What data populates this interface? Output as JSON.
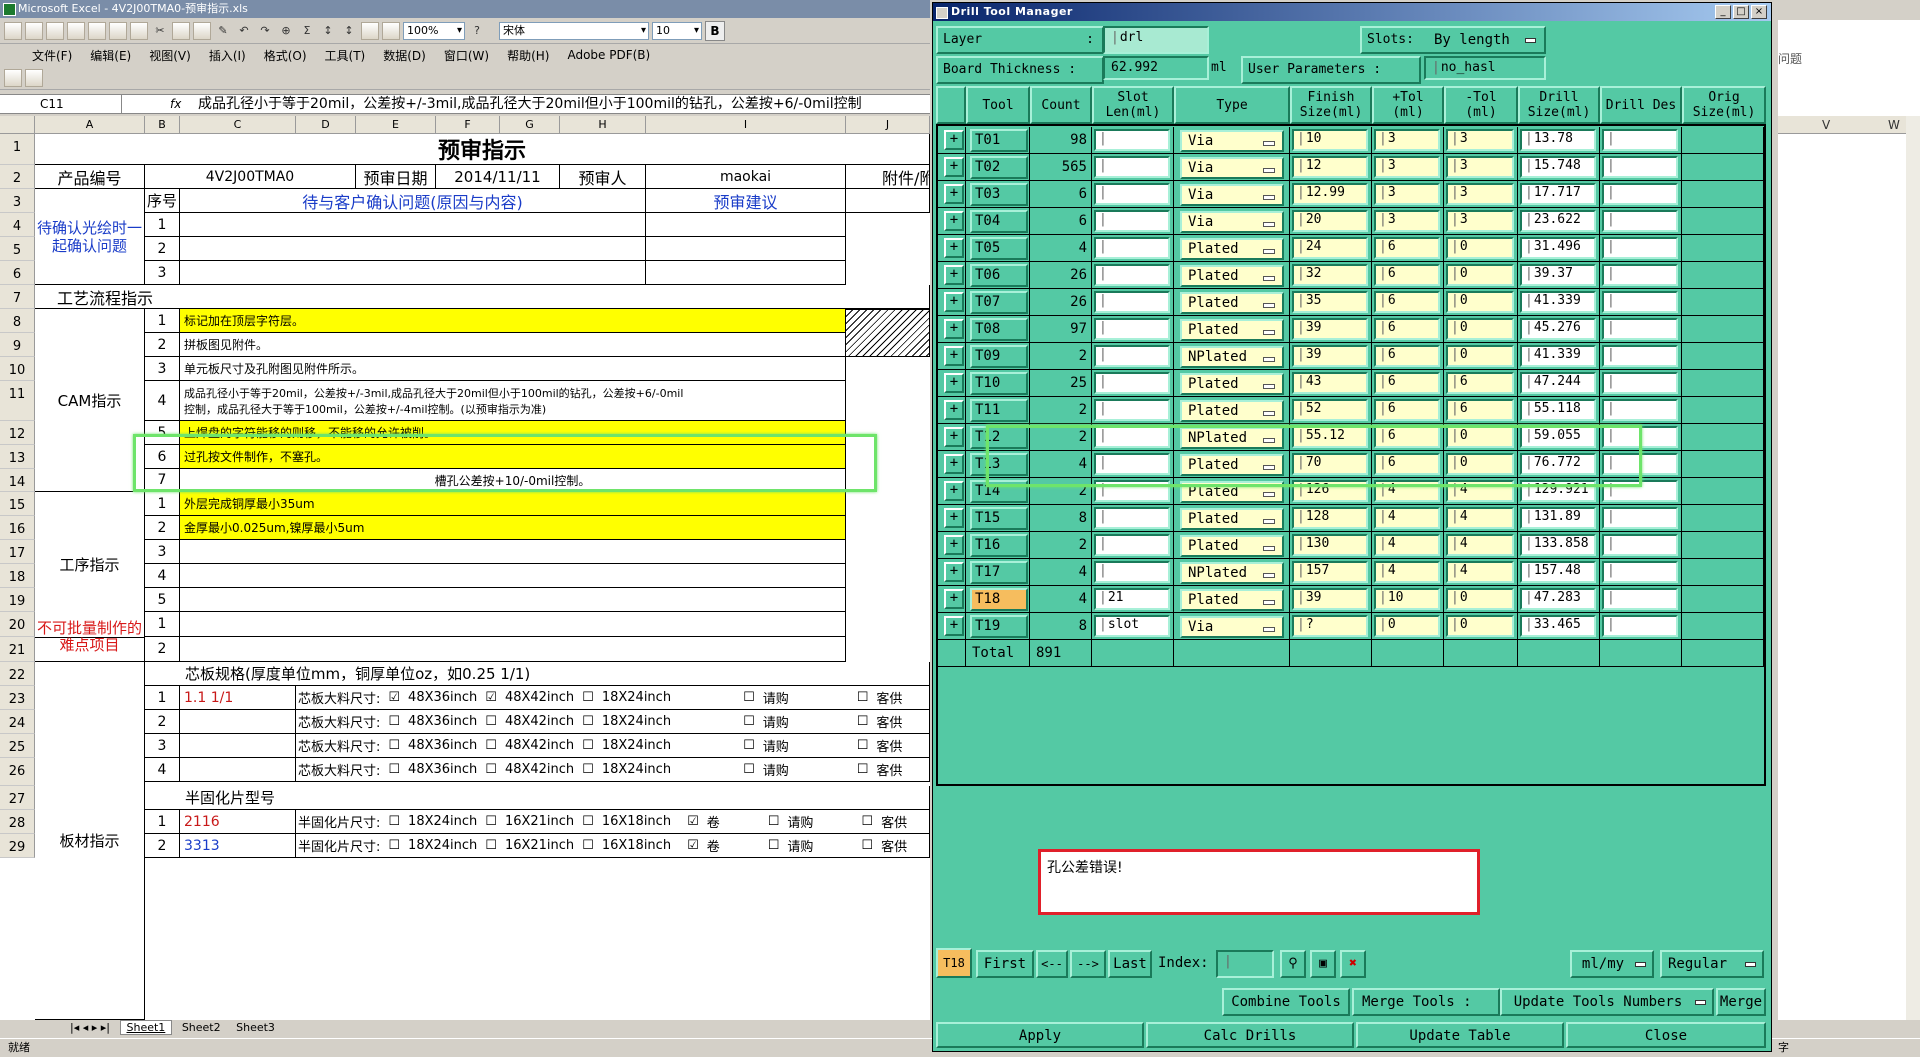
{
  "excel": {
    "window_title": "Microsoft Excel - 4V2J00TMA0-预审指示.xls",
    "font_name": "宋体",
    "font_size": "10",
    "zoom": "100%",
    "menus": [
      "文件(F)",
      "编辑(E)",
      "视图(V)",
      "插入(I)",
      "格式(O)",
      "工具(T)",
      "数据(D)",
      "窗口(W)",
      "帮助(H)",
      "Adobe PDF(B)"
    ],
    "name_box": "C11",
    "fx": "fx",
    "formula": "成品孔径小于等于20mil，公差按+/-3mil,成品孔径大于20mil但小于100mil的钻孔，公差按+6/-0mil控制",
    "columns": [
      "A",
      "B",
      "C",
      "D",
      "E",
      "F",
      "G",
      "H",
      "I",
      "J"
    ],
    "right_columns": [
      "V",
      "W"
    ],
    "right_text": "问题",
    "rows": [
      "1",
      "2",
      "3",
      "4",
      "5",
      "6",
      "7",
      "8",
      "9",
      "10",
      "11",
      "12",
      "13",
      "14",
      "15",
      "16",
      "17",
      "18",
      "19",
      "20",
      "21",
      "22",
      "23",
      "24",
      "25",
      "26",
      "27",
      "28",
      "29"
    ],
    "title": "预审指示",
    "product_no_label": "产品编号",
    "product_no": "4V2J00TMA0",
    "date_label": "预审日期",
    "date": "2014/11/11",
    "reviewer_label": "预审人",
    "reviewer": "maokai",
    "attach_label": "附件/附",
    "seq_label": "序号",
    "confirm_q": "待与客户确认问题(原因与内容)",
    "suggest": "预审建议",
    "confirm_section": "待确认光绘时一起确认问题",
    "flow": "工艺流程指示",
    "cam": "CAM指示",
    "cam_items": [
      "标记加在顶层字符层。",
      "拼板图见附件。",
      "单元板尺寸及孔附图见附件所示。",
      "成品孔径小于等于20mil，公差按+/-3mil,成品孔径大于20mil但小于100mil的钻孔，公差按+6/-0mil",
      "控制，成品孔径大于等于100mil，公差按+/-4mil控制。(以预审指示为准)",
      "上焊盘的字符能移的则移，不能移的允许被削。",
      "过孔按文件制作，不塞孔。",
      "槽孔公差按+10/-0mil控制。"
    ],
    "proc": "工序指示",
    "proc_items": [
      "外层完成铜厚最小35um",
      "金厚最小0.025um,镍厚最小5um"
    ],
    "no_batch": "不可批量制作的难点项目",
    "board": "板材指示",
    "core_spec": "芯板规格(厚度单位mm，铜厚单位oz，如0.25 1/1)",
    "core_value": "1.1 1/1",
    "core_size_label": "芯板大料尺寸:",
    "sizes": [
      "48X36inch",
      "48X42inch",
      "18X24inch"
    ],
    "buy": "请购",
    "customer": "客供",
    "prepreg": "半固化片型号",
    "prepreg_items": [
      "2116",
      "3313"
    ],
    "prepreg_size_label": "半固化片尺寸:",
    "pp_sizes": [
      "18X24inch",
      "16X21inch",
      "16X18inch"
    ],
    "roll": "卷",
    "seq_nums": [
      "1",
      "2",
      "3",
      "4",
      "5",
      "6",
      "7"
    ],
    "sheets": [
      "Sheet1",
      "Sheet2",
      "Sheet3"
    ],
    "status": "就绪",
    "status_right": "字"
  },
  "dialog": {
    "title": "Drill Tool Manager",
    "layer_label": "Layer",
    "layer_value": "drl",
    "slots_label": "Slots:",
    "slots_value": "By length",
    "thickness_label": "Board Thickness :",
    "thickness_value": "62.992",
    "thickness_unit": "ml",
    "user_params_label": "User Parameters :",
    "user_params_value": "no_hasl",
    "headers": [
      "Tool",
      "Count",
      "Slot Len(ml)",
      "Type",
      "Finish Size(ml)",
      "+Tol (ml)",
      "-Tol (ml)",
      "Drill Size(ml)",
      "Drill Des",
      "Orig Size(ml)"
    ],
    "rows": [
      {
        "tool": "T01",
        "count": "98",
        "slot": "",
        "type": "Via",
        "finish": "10",
        "ptol": "3",
        "ntol": "3",
        "drill": "13.78"
      },
      {
        "tool": "T02",
        "count": "565",
        "slot": "",
        "type": "Via",
        "finish": "12",
        "ptol": "3",
        "ntol": "3",
        "drill": "15.748"
      },
      {
        "tool": "T03",
        "count": "6",
        "slot": "",
        "type": "Via",
        "finish": "12.99",
        "ptol": "3",
        "ntol": "3",
        "drill": "17.717"
      },
      {
        "tool": "T04",
        "count": "6",
        "slot": "",
        "type": "Via",
        "finish": "20",
        "ptol": "3",
        "ntol": "3",
        "drill": "23.622"
      },
      {
        "tool": "T05",
        "count": "4",
        "slot": "",
        "type": "Plated",
        "finish": "24",
        "ptol": "6",
        "ntol": "0",
        "drill": "31.496"
      },
      {
        "tool": "T06",
        "count": "26",
        "slot": "",
        "type": "Plated",
        "finish": "32",
        "ptol": "6",
        "ntol": "0",
        "drill": "39.37"
      },
      {
        "tool": "T07",
        "count": "26",
        "slot": "",
        "type": "Plated",
        "finish": "35",
        "ptol": "6",
        "ntol": "0",
        "drill": "41.339"
      },
      {
        "tool": "T08",
        "count": "97",
        "slot": "",
        "type": "Plated",
        "finish": "39",
        "ptol": "6",
        "ntol": "0",
        "drill": "45.276"
      },
      {
        "tool": "T09",
        "count": "2",
        "slot": "",
        "type": "NPlated",
        "finish": "39",
        "ptol": "6",
        "ntol": "0",
        "drill": "41.339"
      },
      {
        "tool": "T10",
        "count": "25",
        "slot": "",
        "type": "Plated",
        "finish": "43",
        "ptol": "6",
        "ntol": "6",
        "drill": "47.244"
      },
      {
        "tool": "T11",
        "count": "2",
        "slot": "",
        "type": "Plated",
        "finish": "52",
        "ptol": "6",
        "ntol": "6",
        "drill": "55.118"
      },
      {
        "tool": "T12",
        "count": "2",
        "slot": "",
        "type": "NPlated",
        "finish": "55.12",
        "ptol": "6",
        "ntol": "0",
        "drill": "59.055"
      },
      {
        "tool": "T13",
        "count": "4",
        "slot": "",
        "type": "Plated",
        "finish": "70",
        "ptol": "6",
        "ntol": "0",
        "drill": "76.772"
      },
      {
        "tool": "T14",
        "count": "2",
        "slot": "",
        "type": "Plated",
        "finish": "126",
        "ptol": "4",
        "ntol": "4",
        "drill": "129.921"
      },
      {
        "tool": "T15",
        "count": "8",
        "slot": "",
        "type": "Plated",
        "finish": "128",
        "ptol": "4",
        "ntol": "4",
        "drill": "131.89"
      },
      {
        "tool": "T16",
        "count": "2",
        "slot": "",
        "type": "Plated",
        "finish": "130",
        "ptol": "4",
        "ntol": "4",
        "drill": "133.858"
      },
      {
        "tool": "T17",
        "count": "4",
        "slot": "",
        "type": "NPlated",
        "finish": "157",
        "ptol": "4",
        "ntol": "4",
        "drill": "157.48"
      },
      {
        "tool": "T18",
        "count": "4",
        "slot": "21",
        "type": "Plated",
        "finish": "39",
        "ptol": "10",
        "ntol": "0",
        "drill": "47.283"
      },
      {
        "tool": "T19",
        "count": "8",
        "slot": "slot",
        "type": "Via",
        "finish": "?",
        "ptol": "0",
        "ntol": "0",
        "drill": "33.465"
      }
    ],
    "total_label": "Total",
    "total_count": "891",
    "error_msg": "孔公差错误!",
    "current_tool": "T18",
    "nav": {
      "first": "First",
      "prev": "<--",
      "next": "-->",
      "last": "Last",
      "index_label": "Index:"
    },
    "unit_value": "ml/my",
    "mode_value": "Regular",
    "buttons": {
      "combine": "Combine Tools",
      "merge_label": "Merge Tools :",
      "update_numbers": "Update Tools Numbers",
      "merge": "Merge",
      "apply": "Apply",
      "calc": "Calc Drills",
      "update_table": "Update Table",
      "close": "Close"
    },
    "colors": {
      "bg": "#54c9a4",
      "selected": "#f6bd5e",
      "input": "#ffffcc",
      "error_border": "#e0202a",
      "highlight": "#6ee46a"
    }
  }
}
